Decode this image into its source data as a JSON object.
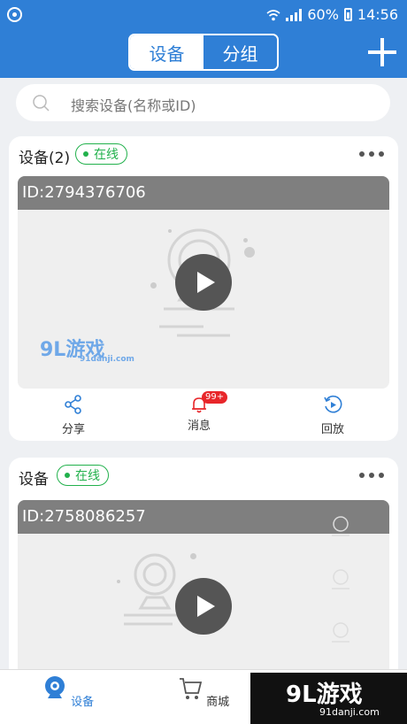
{
  "status_bar": {
    "battery": "60%",
    "time": "14:56"
  },
  "header": {
    "tabs": [
      {
        "label": "设备",
        "active": true
      },
      {
        "label": "分组",
        "active": false
      }
    ],
    "add_icon": "plus-icon"
  },
  "search": {
    "placeholder": "搜索设备(名称或ID)"
  },
  "devices": [
    {
      "name": "设备(2)",
      "status": "在线",
      "id_label": "ID:2794376706",
      "actions": [
        {
          "label": "分享",
          "icon": "share-icon"
        },
        {
          "label": "消息",
          "icon": "bell-icon",
          "badge": "99+"
        },
        {
          "label": "回放",
          "icon": "playback-icon"
        }
      ]
    },
    {
      "name": "设备",
      "status": "在线",
      "id_label": "ID:2758086257"
    }
  ],
  "bottom_nav": [
    {
      "label": "设备",
      "icon": "camera-icon",
      "active": true
    },
    {
      "label": "商城",
      "icon": "cart-icon",
      "active": false
    }
  ],
  "watermark": {
    "logo": "9L游戏",
    "url": "91danji.com"
  },
  "colors": {
    "primary": "#2f7fd6",
    "online": "#22b14c",
    "badge": "#e8262a"
  }
}
